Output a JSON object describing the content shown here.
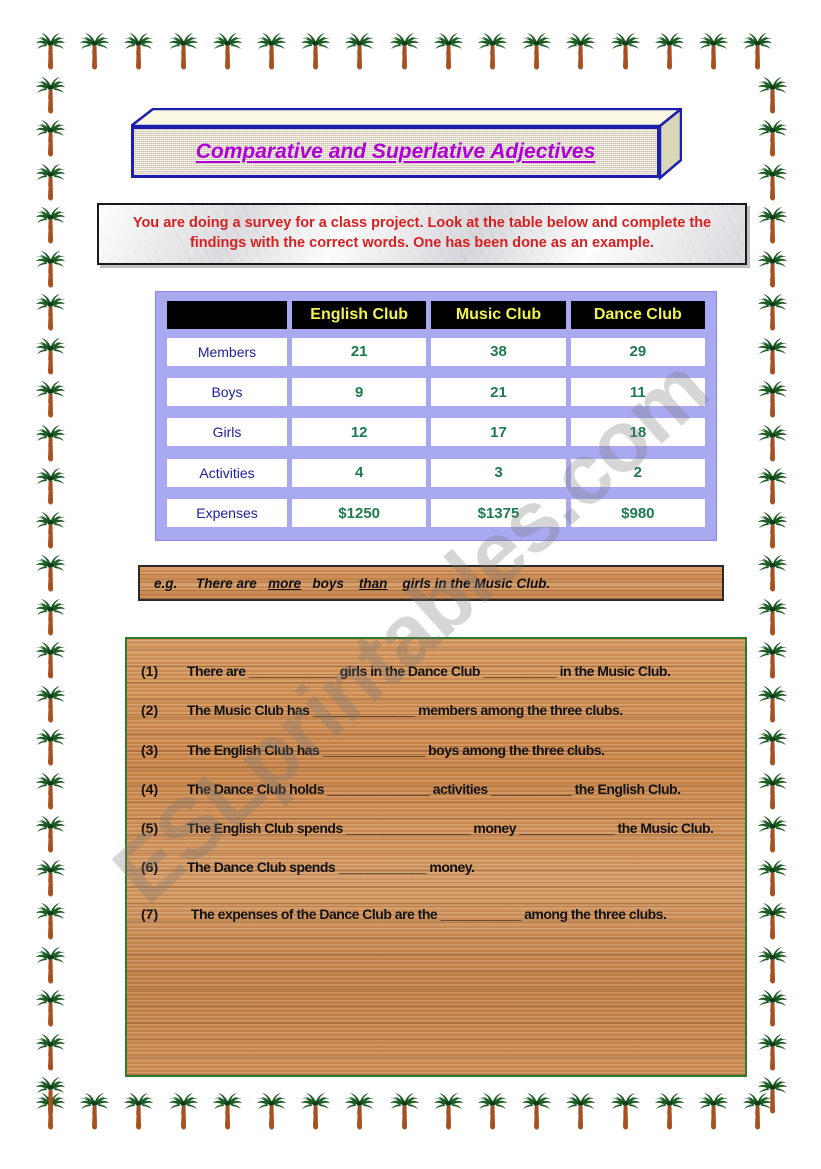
{
  "title": {
    "text": "Comparative and Superlative Adjectives"
  },
  "instructions": {
    "text": "You are doing a survey for a class project. Look at the table below and complete the findings with the correct words. One has been done as an example."
  },
  "watermark": {
    "text": "ESLprintables.com"
  },
  "chart_data": {
    "type": "table",
    "title": "Club survey data",
    "columns": [
      "",
      "English Club",
      "Music Club",
      "Dance Club"
    ],
    "categories": [
      "Members",
      "Boys",
      "Girls",
      "Activities",
      "Expenses"
    ],
    "series": [
      {
        "name": "English Club",
        "values": [
          "21",
          "9",
          "12",
          "4",
          "$1250"
        ]
      },
      {
        "name": "Music Club",
        "values": [
          "38",
          "21",
          "17",
          "3",
          "$1375"
        ]
      },
      {
        "name": "Dance Club",
        "values": [
          "29",
          "11",
          "18",
          "2",
          "$980"
        ]
      }
    ],
    "rows": [
      {
        "label": "Members",
        "cells": [
          "21",
          "38",
          "29"
        ]
      },
      {
        "label": "Boys",
        "cells": [
          "9",
          "21",
          "11"
        ]
      },
      {
        "label": "Girls",
        "cells": [
          "12",
          "17",
          "18"
        ]
      },
      {
        "label": "Activities",
        "cells": [
          "4",
          "3",
          "2"
        ]
      },
      {
        "label": "Expenses",
        "cells": [
          "$1250",
          "$1375",
          "$980"
        ]
      }
    ],
    "header_bg": "#000000",
    "header_color": "#f2f24f",
    "value_color": "#1f7a4d",
    "label_color": "#20209a",
    "grid_bg": "#a9a9f2"
  },
  "example": {
    "label": "e.g.",
    "part1": "There are",
    "answer1": "more",
    "part2": "boys",
    "answer2": "than",
    "part3": "girls  in the Music Club."
  },
  "exercises": [
    {
      "number": "(1)",
      "text": "There are ____________ girls in the Dance Club __________ in the Music Club."
    },
    {
      "number": "(2)",
      "text": "The Music Club has ______________ members among the three clubs."
    },
    {
      "number": "(3)",
      "text": "The English Club has ______________ boys among the three clubs."
    },
    {
      "number": "(4)",
      "text": "The Dance Club holds ______________ activities ___________ the English Club."
    },
    {
      "number": "(5)",
      "text": "The English Club spends _________________ money _____________ the Music Club."
    },
    {
      "number": "(6)",
      "text": "The Dance Club spends ____________ money."
    },
    {
      "number": "(7)",
      "text": "The expenses of the Dance Club are the ___________ among the three clubs."
    }
  ],
  "decor": {
    "palm_frond_color": "#1e5c26",
    "palm_frond_dark": "#0f3d16",
    "palm_trunk_color": "#a8511f",
    "border_color": "#2f7a2f",
    "title_border": "#1d1dae",
    "title_text_color": "#b000d6",
    "instruction_color": "#d91f1f"
  }
}
